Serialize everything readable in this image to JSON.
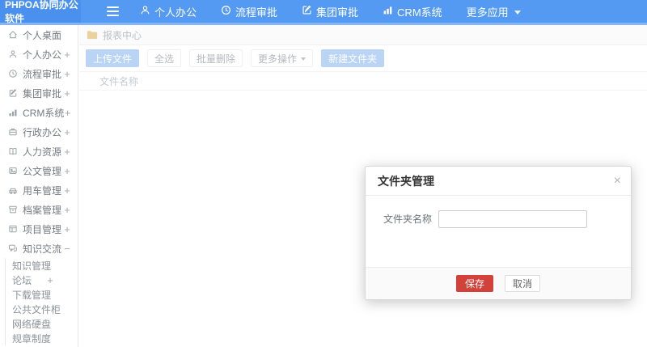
{
  "colors": {
    "navbar_blue": "#549af3",
    "logo_blue": "#4a91ef",
    "accent_button_blue": "#b9d4f4",
    "save_red": "#d2423a",
    "folder_yellow": "#e9d29d"
  },
  "navbar": {
    "logo": "PHPOA协同办公软件",
    "items": [
      {
        "label": "个人办公",
        "icon": "user-icon"
      },
      {
        "label": "流程审批",
        "icon": "clock-icon"
      },
      {
        "label": "集团审批",
        "icon": "edit-icon"
      },
      {
        "label": "CRM系统",
        "icon": "bar-chart-icon"
      },
      {
        "label": "更多应用",
        "icon": "caret-down-icon"
      }
    ]
  },
  "sidebar": {
    "items": [
      {
        "label": "个人桌面",
        "icon": "home-icon",
        "expand": ""
      },
      {
        "label": "个人办公",
        "icon": "user-icon",
        "expand": "+"
      },
      {
        "label": "流程审批",
        "icon": "clock-icon",
        "expand": "+"
      },
      {
        "label": "集团审批",
        "icon": "edit-icon",
        "expand": "+"
      },
      {
        "label": "CRM系统",
        "icon": "bar-chart-icon",
        "expand": "+"
      },
      {
        "label": "行政办公",
        "icon": "briefcase-icon",
        "expand": "+"
      },
      {
        "label": "人力资源",
        "icon": "book-icon",
        "expand": "+"
      },
      {
        "label": "公文管理",
        "icon": "document-icon",
        "expand": "+"
      },
      {
        "label": "用车管理",
        "icon": "car-icon",
        "expand": "+"
      },
      {
        "label": "档案管理",
        "icon": "archive-icon",
        "expand": "+"
      },
      {
        "label": "项目管理",
        "icon": "project-icon",
        "expand": "+"
      },
      {
        "label": "知识交流",
        "icon": "chat-icon",
        "expand": "−"
      }
    ],
    "subitems": [
      {
        "label": "知识管理",
        "expand": ""
      },
      {
        "label": "论坛",
        "expand": "+"
      },
      {
        "label": "下载管理",
        "expand": ""
      },
      {
        "label": "公共文件柜",
        "expand": ""
      },
      {
        "label": "网络硬盘",
        "expand": ""
      },
      {
        "label": "规章制度",
        "expand": ""
      }
    ]
  },
  "breadcrumb": {
    "label": "报表中心",
    "icon": "folder-icon"
  },
  "toolbar": {
    "upload": "上传文件",
    "select_all": "全选",
    "batch_delete": "批量删除",
    "more_ops": "更多操作",
    "new_folder": "新建文件夹"
  },
  "file_list": {
    "name_header": "文件名称"
  },
  "modal": {
    "title": "文件夹管理",
    "close": "×",
    "field_label": "文件夹名称",
    "field_value": "",
    "save": "保存",
    "cancel": "取消"
  }
}
